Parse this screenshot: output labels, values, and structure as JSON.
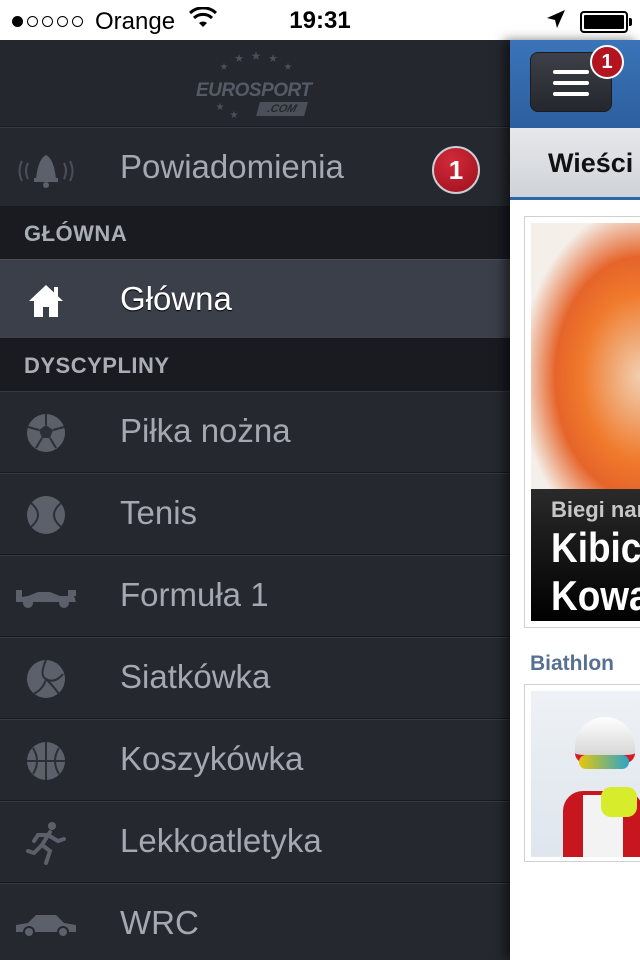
{
  "status_bar": {
    "signal_dots": [
      true,
      false,
      false,
      false,
      false
    ],
    "carrier": "Orange",
    "time": "19:31"
  },
  "menu": {
    "logo": {
      "word": "EUROSPORT",
      "domain": ".COM"
    },
    "notifications": {
      "label": "Powiadomienia",
      "badge": "1",
      "icon": "bell-icon"
    },
    "sections": [
      {
        "title": "GŁÓWNA",
        "items": [
          {
            "label": "Główna",
            "icon": "home-icon",
            "active": true
          }
        ]
      },
      {
        "title": "DYSCYPLINY",
        "items": [
          {
            "label": "Piłka nożna",
            "icon": "football-icon"
          },
          {
            "label": "Tenis",
            "icon": "tennis-ball-icon"
          },
          {
            "label": "Formuła 1",
            "icon": "f1-car-icon"
          },
          {
            "label": "Siatkówka",
            "icon": "volleyball-icon"
          },
          {
            "label": "Koszykówka",
            "icon": "basketball-icon"
          },
          {
            "label": "Lekkoatletyka",
            "icon": "runner-icon"
          },
          {
            "label": "WRC",
            "icon": "rally-car-icon"
          }
        ]
      }
    ]
  },
  "content": {
    "menu_button_badge": "1",
    "tab": "Wieści",
    "hero": {
      "kicker": "Biegi nar",
      "title_lines": [
        "Kibic",
        "Kowa"
      ]
    },
    "section_label": "Biathlon"
  },
  "colors": {
    "menu_bg": "#24272e",
    "section_bg": "#191b20",
    "active_row": "#3b3f49",
    "badge_red": "#b3141f",
    "header_blue": "#2c5f9e"
  }
}
